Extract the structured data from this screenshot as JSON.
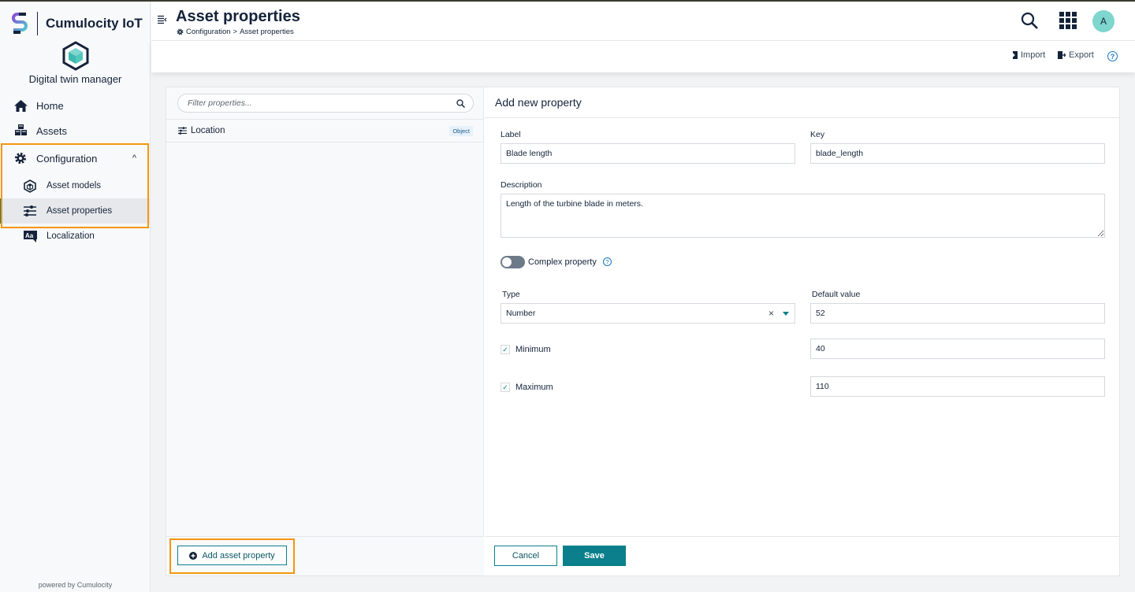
{
  "brand": {
    "name": "Cumulocity IoT",
    "app_name": "Digital twin manager",
    "powered_by": "powered by Cumulocity"
  },
  "sidebar": {
    "items": [
      {
        "label": "Home",
        "icon": "home-icon"
      },
      {
        "label": "Assets",
        "icon": "assets-icon"
      },
      {
        "label": "Configuration",
        "icon": "gear-icon",
        "expanded": true,
        "children": [
          {
            "label": "Asset models",
            "icon": "cube-icon"
          },
          {
            "label": "Asset properties",
            "icon": "sliders-icon",
            "active": true
          }
        ]
      },
      {
        "label": "Localization",
        "icon": "localization-icon"
      }
    ]
  },
  "header": {
    "title": "Asset properties",
    "breadcrumb": [
      "Configuration",
      "Asset properties"
    ],
    "breadcrumb_sep": ">",
    "avatar_initial": "A"
  },
  "actions": {
    "import": "Import",
    "export": "Export",
    "help": "?"
  },
  "left": {
    "filter_placeholder": "Filter properties...",
    "properties": [
      {
        "label": "Location",
        "badge": "Object"
      }
    ],
    "add_button": "Add asset property"
  },
  "form": {
    "title": "Add new property",
    "label_label": "Label",
    "label_value": "Blade length",
    "key_label": "Key",
    "key_value": "blade_length",
    "description_label": "Description",
    "description_value": "Length of the turbine blade in meters.",
    "complex_label": "Complex property",
    "complex_on": false,
    "type_label": "Type",
    "type_value": "Number",
    "default_label": "Default value",
    "default_value": "52",
    "minimum_label": "Minimum",
    "minimum_checked": true,
    "minimum_value": "40",
    "maximum_label": "Maximum",
    "maximum_checked": true,
    "maximum_value": "110",
    "cancel": "Cancel",
    "save": "Save"
  },
  "colors": {
    "accent": "#0b7f8c",
    "highlight": "#f4960f",
    "avatar": "#7ed6ce",
    "link": "#1776bf"
  }
}
